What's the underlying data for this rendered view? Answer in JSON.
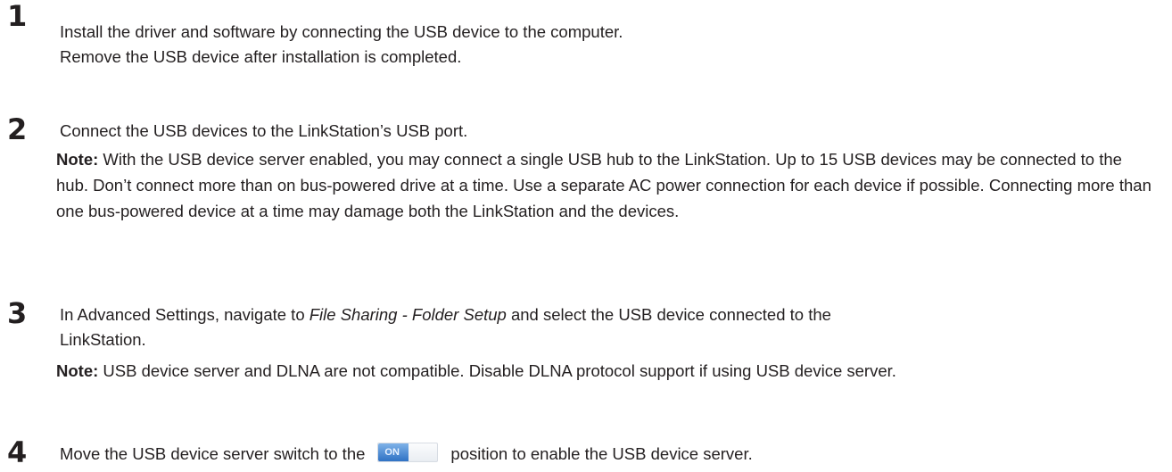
{
  "steps": [
    {
      "number": "1",
      "lines": [
        "Install the driver and software by connecting the USB device to the computer.",
        "Remove the USB device after installation is completed."
      ]
    },
    {
      "number": "2",
      "lines": [
        "Connect the USB devices to the LinkStation’s USB port."
      ],
      "note": {
        "label": "Note:",
        "text": " With the USB device server enabled, you may connect a single USB hub to the LinkStation. Up to 15 USB devices may be connected to the hub. Don’t connect more than on bus-powered drive at a time. Use a separate AC power connection for each device if possible. Connecting more than one bus-powered device at a time may damage both the LinkStation and the devices."
      }
    },
    {
      "number": "3",
      "text_a": "In Advanced Settings, navigate to ",
      "text_italic": "File Sharing - Folder Setup",
      "text_b": " and select the USB device connected to the",
      "text_line2": "LinkStation.",
      "note": {
        "label": "Note:",
        "text": " USB device server and DLNA are not compatible. Disable DLNA protocol support if using USB device server."
      }
    },
    {
      "number": "4",
      "text_a": "Move the USB device server switch to the",
      "switch_label": "ON",
      "text_b": "position to enable the USB device server."
    }
  ]
}
